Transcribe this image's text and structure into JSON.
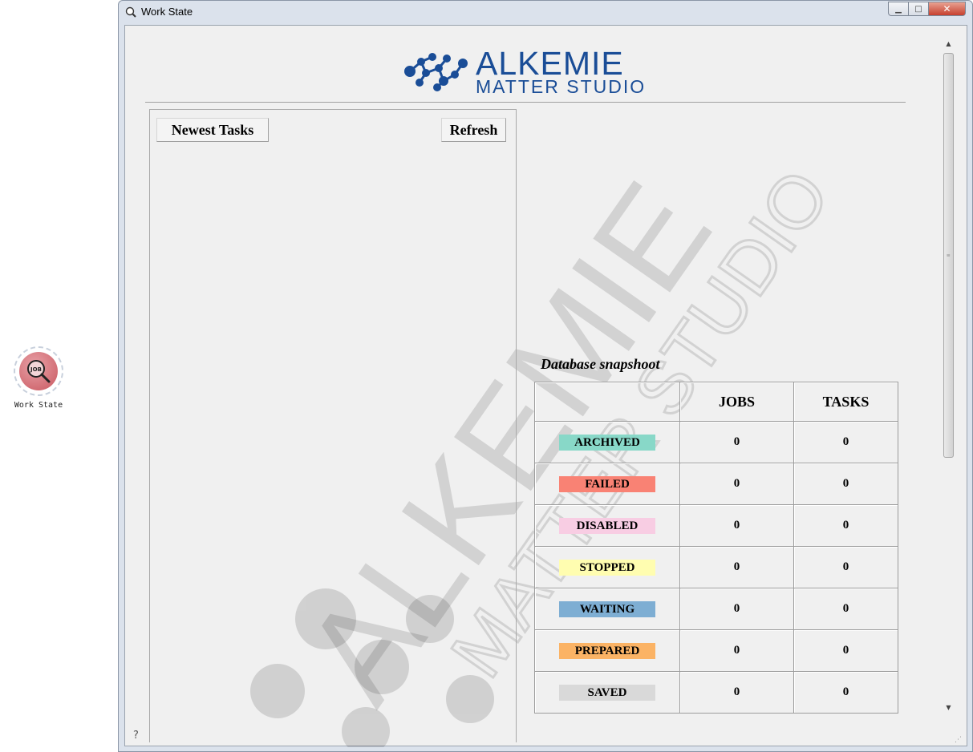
{
  "desktop": {
    "icon_label": "Work State",
    "icon_text": "JOB"
  },
  "window": {
    "title": "Work State"
  },
  "logo": {
    "main": "ALKEMIE",
    "sub": "MATTER STUDIO"
  },
  "buttons": {
    "newest": "Newest Tasks",
    "refresh": "Refresh"
  },
  "snapshot": {
    "title": "Database snapshoot",
    "headers": [
      "",
      "JOBS",
      "TASKS"
    ],
    "rows": [
      {
        "label": "ARCHIVED",
        "color": "#88d8c8",
        "jobs": "0",
        "tasks": "0"
      },
      {
        "label": "FAILED",
        "color": "#f98274",
        "jobs": "0",
        "tasks": "0"
      },
      {
        "label": "DISABLED",
        "color": "#f8cde3",
        "jobs": "0",
        "tasks": "0"
      },
      {
        "label": "STOPPED",
        "color": "#fffdb0",
        "jobs": "0",
        "tasks": "0"
      },
      {
        "label": "WAITING",
        "color": "#7eaed3",
        "jobs": "0",
        "tasks": "0"
      },
      {
        "label": "PREPARED",
        "color": "#fbb365",
        "jobs": "0",
        "tasks": "0"
      },
      {
        "label": "SAVED",
        "color": "#d9d9d9",
        "jobs": "0",
        "tasks": "0"
      }
    ]
  },
  "colors": {
    "brand": "#1a4d97"
  }
}
